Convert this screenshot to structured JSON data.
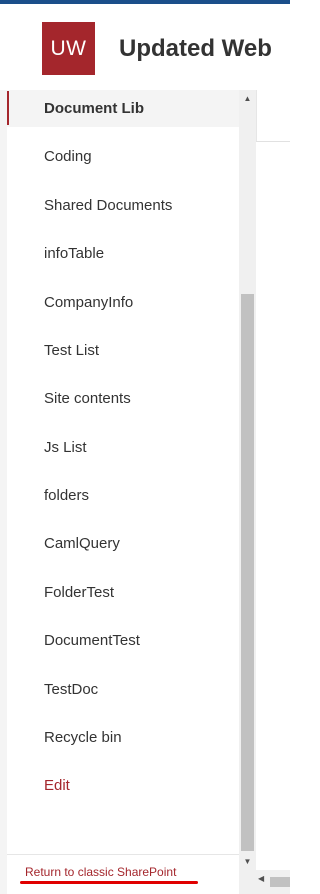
{
  "header": {
    "logo_text": "UW",
    "site_title": "Updated Web"
  },
  "nav": {
    "items": [
      {
        "label": "Document Lib",
        "selected": true
      },
      {
        "label": "Coding"
      },
      {
        "label": "Shared Documents"
      },
      {
        "label": "infoTable"
      },
      {
        "label": "CompanyInfo"
      },
      {
        "label": "Test List"
      },
      {
        "label": "Site contents"
      },
      {
        "label": "Js List"
      },
      {
        "label": "folders"
      },
      {
        "label": "CamlQuery"
      },
      {
        "label": "FolderTest"
      },
      {
        "label": "DocumentTest"
      },
      {
        "label": "TestDoc"
      },
      {
        "label": "Recycle bin"
      },
      {
        "label": "Edit"
      }
    ]
  },
  "footer": {
    "classic_link": "Return to classic SharePoint"
  },
  "icons": {
    "scroll_up": "chevron-up-icon",
    "scroll_down": "chevron-down-icon",
    "scroll_left": "chevron-left-icon"
  },
  "colors": {
    "accent": "#a4262c",
    "annotation_underline": "#e00000",
    "top_strip": "#1b4f8a"
  }
}
